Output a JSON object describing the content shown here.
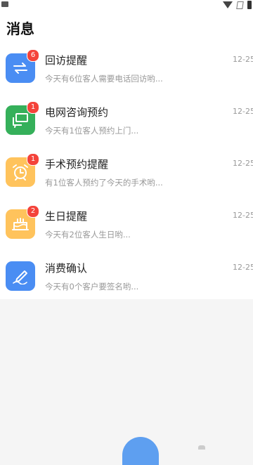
{
  "page": {
    "title": "消息"
  },
  "messages": [
    {
      "title": "回访提醒",
      "time": "12-25",
      "preview": "今天有6位客人需要电话回访哟...",
      "badge": "6",
      "color": "#4a8df3",
      "icon": "swap-arrows-icon"
    },
    {
      "title": "电网咨询预约",
      "time": "12-25",
      "preview": "今天有1位客人预约上门...",
      "badge": "1",
      "color": "#35b05a",
      "icon": "chat-bubbles-icon"
    },
    {
      "title": "手术预约提醒",
      "time": "12-25",
      "preview": "有1位客人预约了今天的手术哟...",
      "badge": "1",
      "color": "#ffc35c",
      "icon": "alarm-clock-icon"
    },
    {
      "title": "生日提醒",
      "time": "12-25",
      "preview": "今天有2位客人生日哟...",
      "badge": "2",
      "color": "#ffc35c",
      "icon": "birthday-cake-icon"
    },
    {
      "title": "消费确认",
      "time": "12-25",
      "preview": "今天有0个客户要签名哟...",
      "badge": "",
      "color": "#4a8df3",
      "icon": "pen-sign-icon"
    }
  ]
}
